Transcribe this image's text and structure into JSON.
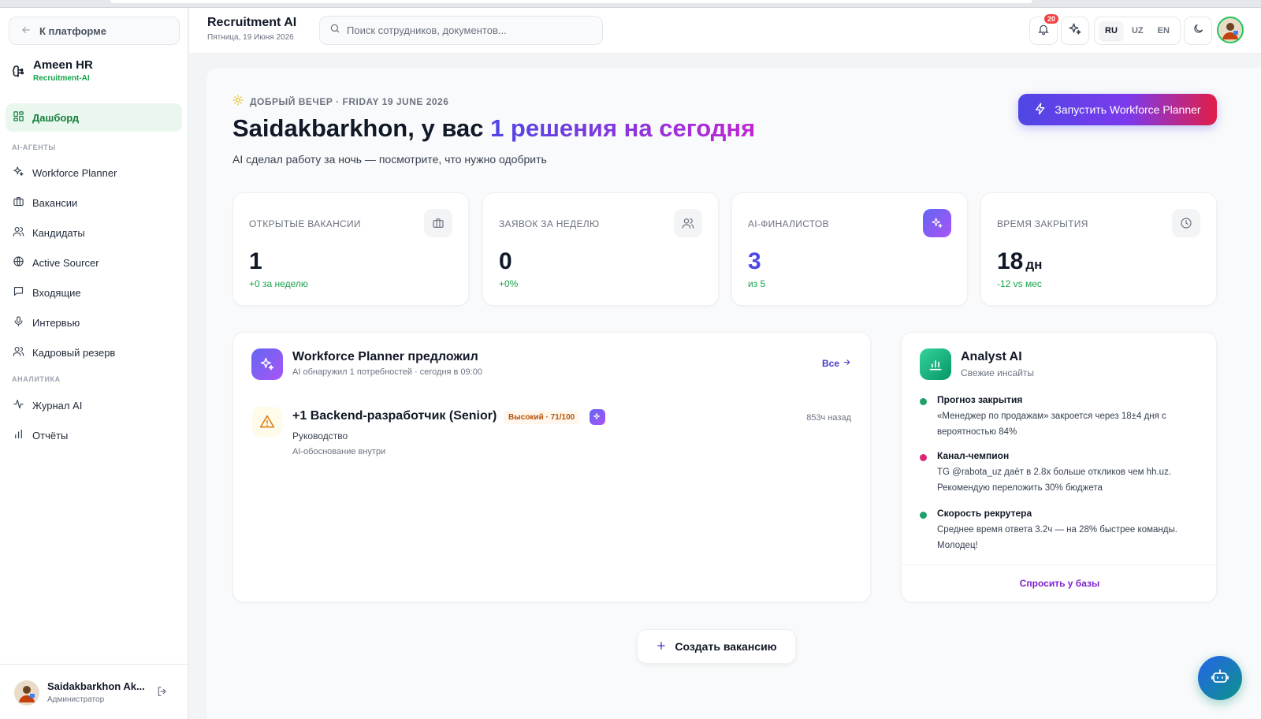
{
  "sidebar": {
    "back_label": "К платформе",
    "brand_name": "Ameen HR",
    "brand_sub": "Recruitment-AI",
    "dashboard_label": "Дашборд",
    "section_agents": "AI-АГЕНТЫ",
    "section_analytics": "АНАЛИТИКА",
    "items": [
      {
        "label": "Workforce Planner",
        "icon": "sparkles-icon"
      },
      {
        "label": "Вакансии",
        "icon": "briefcase-icon"
      },
      {
        "label": "Кандидаты",
        "icon": "users-icon"
      },
      {
        "label": "Active Sourcer",
        "icon": "globe-icon"
      },
      {
        "label": "Входящие",
        "icon": "message-icon"
      },
      {
        "label": "Интервью",
        "icon": "microphone-icon"
      },
      {
        "label": "Кадровый резерв",
        "icon": "users-icon"
      }
    ],
    "analytics_items": [
      {
        "label": "Журнал AI",
        "icon": "activity-icon"
      },
      {
        "label": "Отчёты",
        "icon": "bar-chart-icon"
      }
    ],
    "user": {
      "name": "Saidakbarkhon Ak...",
      "role": "Администратор"
    }
  },
  "header": {
    "title": "Recruitment AI",
    "date": "Пятница, 19 Июня 2026",
    "search_placeholder": "Поиск сотрудников, документов...",
    "notifications_count": "20",
    "languages": [
      "RU",
      "UZ",
      "EN"
    ],
    "selected_language": "RU"
  },
  "main": {
    "greeting": "ДОБРЫЙ ВЕЧЕР · FRIDAY 19 JUNE 2026",
    "headline_prefix": "Saidakbarkhon, у вас ",
    "headline_highlight": "1 решения на сегодня",
    "subline": "AI сделал работу за ночь — посмотрите, что нужно одобрить",
    "cta_label": "Запустить Workforce Planner",
    "stats": [
      {
        "label": "ОТКРЫТЫЕ ВАКАНСИИ",
        "value": "1",
        "unit": "",
        "delta": "+0 за неделю",
        "icon": "briefcase-icon"
      },
      {
        "label": "ЗАЯВОК ЗА НЕДЕЛЮ",
        "value": "0",
        "unit": "",
        "delta": "+0%",
        "icon": "users-icon"
      },
      {
        "label": "AI-ФИНАЛИСТОВ",
        "value": "3",
        "unit": "",
        "delta": "из 5",
        "icon": "sparkles-icon"
      },
      {
        "label": "ВРЕМЯ ЗАКРЫТИЯ",
        "value": "18",
        "unit": "дн",
        "delta": "-12 vs мес",
        "icon": "clock-icon"
      }
    ],
    "workforce": {
      "title": "Workforce Planner предложил",
      "subtitle": "AI обнаружил 1 потребностей · сегодня в 09:00",
      "all_label": "Все",
      "item": {
        "title": "+1 Backend-разработчик (Senior)",
        "priority": "Высокий · 71/100",
        "time": "853ч назад",
        "department": "Руководство",
        "hint": "AI-обоснование внутри"
      }
    },
    "analyst": {
      "title": "Analyst AI",
      "subtitle": "Свежие инсайты",
      "insights": [
        {
          "title": "Прогноз закрытия",
          "body": "«Менеджер по продажам» закроется через 18±4 дня с вероятностью 84%",
          "color": "#22a06b"
        },
        {
          "title": "Канал-чемпион",
          "body": "TG @rabota_uz даёт в 2.8x больше откликов чем hh.uz. Рекомендую переложить 30% бюджета",
          "color": "#db2777"
        },
        {
          "title": "Скорость рекрутера",
          "body": "Среднее время ответа 3.2ч — на 28% быстрее команды. Молодец!",
          "color": "#22a06b"
        }
      ],
      "ask_label": "Спросить у базы"
    },
    "create_label": "Создать вакансию"
  }
}
